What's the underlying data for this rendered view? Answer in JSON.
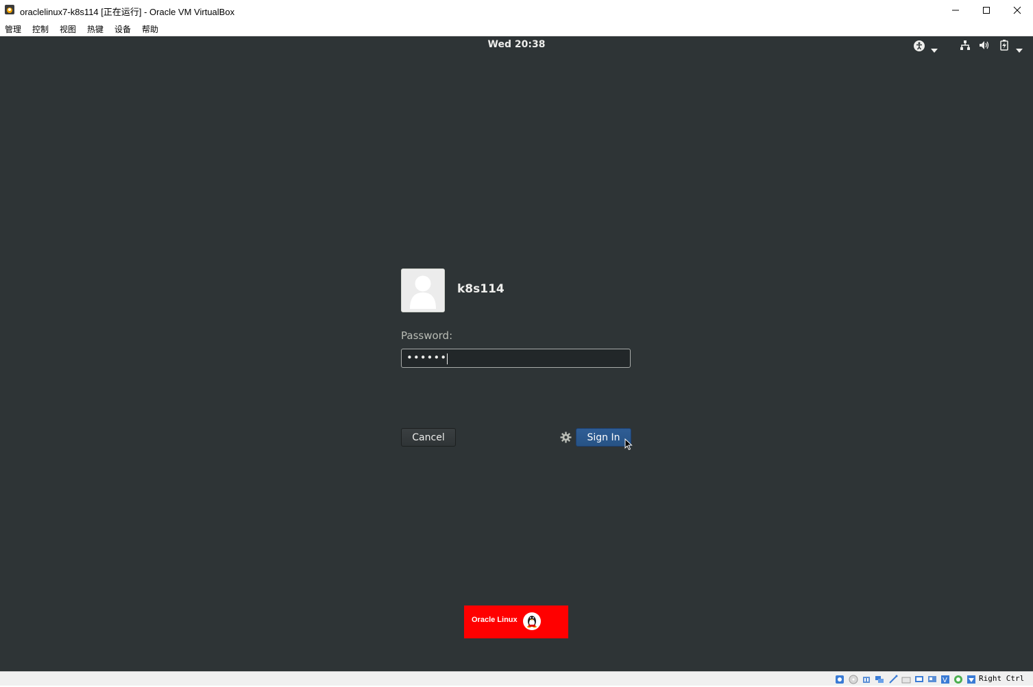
{
  "window": {
    "title": "oraclelinux7-k8s114 [正在运行] - Oracle VM VirtualBox",
    "minimize_icon": "minimize-icon",
    "maximize_icon": "maximize-icon",
    "close_icon": "close-icon"
  },
  "menu": {
    "items": [
      "管理",
      "控制",
      "视图",
      "热键",
      "设备",
      "帮助"
    ]
  },
  "guest": {
    "topbar": {
      "clock": "Wed 20:38",
      "tray_icons": [
        "accessibility-icon",
        "network-icon",
        "volume-icon",
        "battery-icon",
        "dropdown-arrow-icon"
      ]
    },
    "login": {
      "username": "k8s114",
      "password_label": "Password:",
      "password_value": "••••••",
      "cancel_label": "Cancel",
      "signin_label": "Sign In",
      "gear_icon": "gear-icon"
    },
    "logo": {
      "text": "Oracle Linux"
    },
    "colors": {
      "background": "#2e3436",
      "signin": "#2b5a8f",
      "logo": "#ff0000"
    }
  },
  "statusbar": {
    "host_key": "Right Ctrl"
  }
}
